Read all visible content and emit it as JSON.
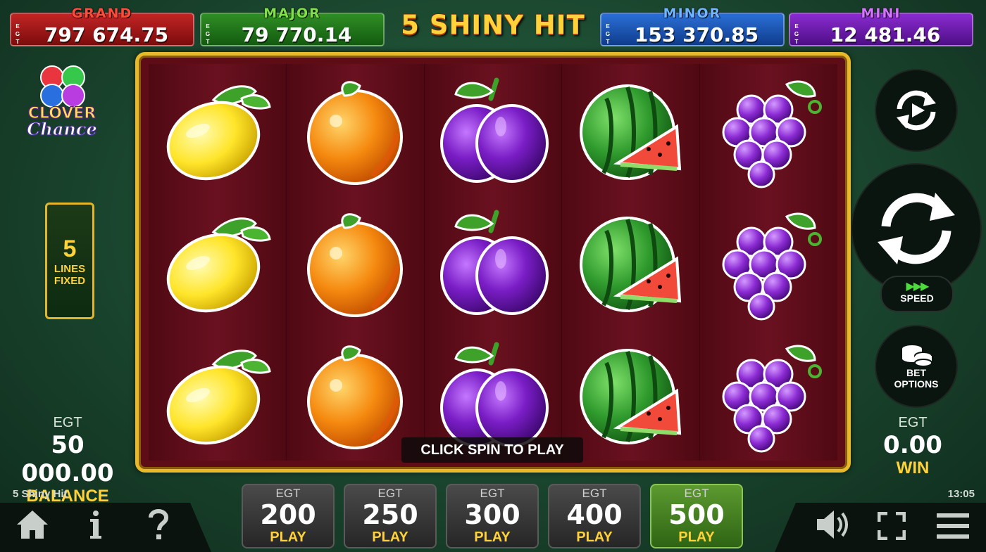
{
  "jackpots": {
    "grand": {
      "title": "GRAND",
      "value": "797 674.75",
      "tag": [
        "E",
        "G",
        "T"
      ]
    },
    "major": {
      "title": "MAJOR",
      "value": "79 770.14",
      "tag": [
        "E",
        "G",
        "T"
      ]
    },
    "minor": {
      "title": "MINOR",
      "value": "153 370.85",
      "tag": [
        "E",
        "G",
        "T"
      ]
    },
    "mini": {
      "title": "MINI",
      "value": "12 481.46",
      "tag": [
        "E",
        "G",
        "T"
      ]
    }
  },
  "game_title": "5 SHINY HIT",
  "logo": {
    "line1": "CLOVER",
    "line2": "Chance"
  },
  "lines": {
    "count": "5",
    "label1": "LINES",
    "label2": "FIXED"
  },
  "reels": [
    [
      "lemon",
      "lemon",
      "lemon"
    ],
    [
      "orange",
      "orange",
      "orange"
    ],
    [
      "plum",
      "plum",
      "plum"
    ],
    [
      "watermelon",
      "watermelon",
      "watermelon"
    ],
    [
      "grapes",
      "grapes",
      "grapes"
    ]
  ],
  "message": "CLICK SPIN TO PLAY",
  "balance": {
    "currency": "EGT",
    "amount": "50 000.00",
    "label": "BALANCE"
  },
  "win": {
    "currency": "EGT",
    "amount": "0.00",
    "label": "WIN"
  },
  "controls": {
    "speed_label": "SPEED",
    "speed_arrows": "▶▶▶",
    "bet_options_line1": "BET",
    "bet_options_line2": "OPTIONS"
  },
  "bets": [
    {
      "currency": "EGT",
      "amount": "200",
      "label": "PLAY",
      "active": false
    },
    {
      "currency": "EGT",
      "amount": "250",
      "label": "PLAY",
      "active": false
    },
    {
      "currency": "EGT",
      "amount": "300",
      "label": "PLAY",
      "active": false
    },
    {
      "currency": "EGT",
      "amount": "400",
      "label": "PLAY",
      "active": false
    },
    {
      "currency": "EGT",
      "amount": "500",
      "label": "PLAY",
      "active": true
    }
  ],
  "footer": {
    "game_name": "5 Shiny Hit",
    "time": "13:05"
  },
  "icons": {
    "home": "home-icon",
    "info": "info-icon",
    "help": "help-icon",
    "sound": "sound-icon",
    "fullscreen": "fullscreen-icon",
    "menu": "menu-icon"
  },
  "colors": {
    "accent_gold": "#ffd23a",
    "active_bet": "#5c9a2f",
    "reel_bg": "#5e0d17"
  }
}
